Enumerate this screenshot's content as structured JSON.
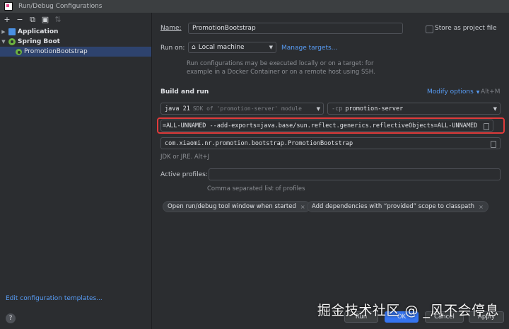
{
  "window": {
    "title": "Run/Debug Configurations"
  },
  "toolbar": {
    "add": "+",
    "remove": "−",
    "copy": "⧉",
    "save": "▣",
    "sort": "⇅"
  },
  "tree": {
    "application": "Application",
    "spring_boot": "Spring Boot",
    "config": "PromotionBootstrap"
  },
  "sidebar": {
    "edit_templates": "Edit configuration templates...",
    "help": "?"
  },
  "form": {
    "name_label": "Name:",
    "name_value": "PromotionBootstrap",
    "store_label": "Store as project file",
    "run_on_label": "Run on:",
    "run_on_value": "Local machine",
    "manage_targets": "Manage targets...",
    "run_on_hint_1": "Run configurations may be executed locally or on a target: for",
    "run_on_hint_2": "example in a Docker Container or on a remote host using SSH.",
    "build_run_label": "Build and run",
    "modify_options": "Modify options",
    "modify_shortcut": "Alt+M",
    "jdk_value_main": "java 21",
    "jdk_value_sub": "SDK of 'promotion-server' module",
    "cp_prefix": "-cp",
    "cp_value": "promotion-server",
    "vm_options": "=ALL-UNNAMED --add-exports=java.base/sun.reflect.generics.reflectiveObjects=ALL-UNNAMED",
    "main_class": "com.xiaomi.nr.promotion.bootstrap.PromotionBootstrap",
    "jdk_hint": "JDK or JRE. Alt+J",
    "active_profiles_label": "Active profiles:",
    "active_profiles_value": "",
    "profiles_hint": "Comma separated list of profiles",
    "chip1": "Open run/debug tool window when started",
    "chip2": "Add dependencies with “provided” scope to classpath",
    "chip_close": "×"
  },
  "buttons": {
    "run": "Run",
    "ok": "OK",
    "cancel": "Cancel",
    "apply": "Apply"
  },
  "watermark": "掘金技术社区 @ _风不会停息"
}
